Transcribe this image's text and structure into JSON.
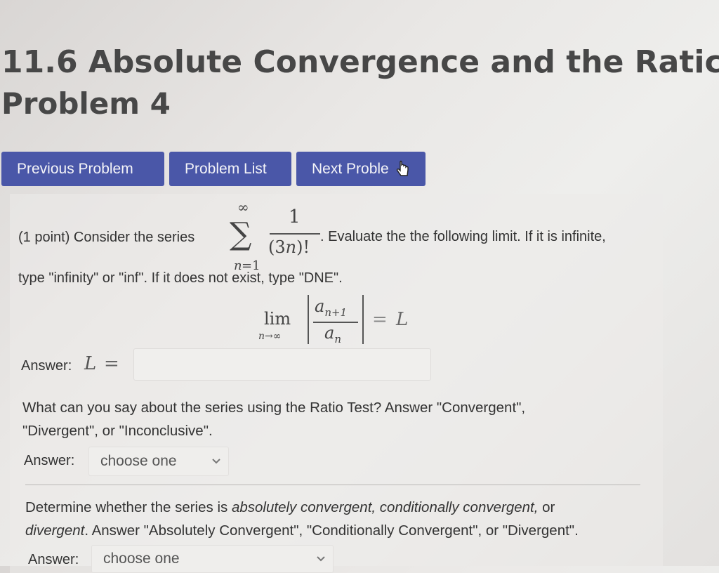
{
  "header": {
    "title": "11.6 Absolute Convergence and the Ratic",
    "subtitle": "Problem 4"
  },
  "nav": {
    "previous": "Previous Problem",
    "list": "Problem List",
    "next": "Next Proble"
  },
  "problem": {
    "intro": "(1 point) Consider the series",
    "series": {
      "upper": "∞",
      "numerator": "1",
      "denominator_open": "(3",
      "denominator_var": "n",
      "denominator_close": ")!",
      "lower_var": "n",
      "lower_rest": "=1"
    },
    "after_series": ". Evaluate the the following limit. If it is infinite,",
    "line2": "type \"infinity\" or \"inf\". If it does not exist, type \"DNE\".",
    "limit": {
      "lim": "lim",
      "sub_var": "n",
      "sub_rest": "→∞",
      "num_var": "a",
      "num_sub": "n+1",
      "den_var": "a",
      "den_sub": "n",
      "equals": "=",
      "rhs": "L"
    },
    "answer_label": "Answer:",
    "answer_var": "L",
    "answer_eq": "=",
    "answer_value": ""
  },
  "ratio_test": {
    "question_line1": "What can you say about the series using the Ratio Test? Answer \"Convergent\",",
    "question_line2": "\"Divergent\", or \"Inconclusive\".",
    "answer_label": "Answer:",
    "selected": "choose one"
  },
  "absolute": {
    "q_pre": "Determine whether the series is ",
    "q_it1": "absolutely convergent, conditionally convergent,",
    "q_or": " or",
    "q_it2": "divergent",
    "q_post": ". Answer \"Absolutely Convergent\", \"Conditionally Convergent\", or \"Divergent\".",
    "answer_label": "Answer:",
    "selected": "choose one"
  },
  "colors": {
    "button": "#4a57a8",
    "title": "#474747"
  }
}
